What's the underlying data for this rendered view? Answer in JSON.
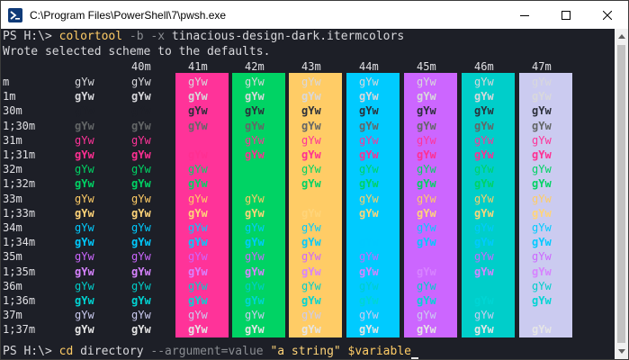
{
  "window": {
    "title": "C:\\Program Files\\PowerShell\\7\\pwsh.exe",
    "app_icon": "powershell-icon",
    "controls": [
      "minimize-icon",
      "maximize-icon",
      "close-icon"
    ]
  },
  "terminal": {
    "line1": {
      "prompt": "PS H:\\> ",
      "cmd": "colortool",
      "flag1": " -b",
      "flag2": " -x",
      "arg": " tinacious-design-dark.itermcolors"
    },
    "line2": "Wrote selected scheme to the defaults.",
    "last_line": {
      "prompt": "PS H:\\> ",
      "cmd": "cd",
      "arg1": " directory",
      "param": " --argument=value",
      "str": " \"a string\"",
      "var": " $variable"
    }
  },
  "color_table": {
    "columns": [
      "",
      "",
      "40m",
      "41m",
      "42m",
      "43m",
      "44m",
      "45m",
      "46m",
      "47m"
    ],
    "rows": [
      "m",
      "1m",
      "30m",
      "1;30m",
      "31m",
      "1;31m",
      "32m",
      "1;32m",
      "33m",
      "1;33m",
      "34m",
      "1;34m",
      "35m",
      "1;35m",
      "36m",
      "1;36m",
      "37m",
      "1;37m"
    ],
    "sample_text": "gYw",
    "background_colors": [
      "#1d1f27",
      "#1d1f27",
      "#1d1f27",
      "#ff3399",
      "#00d364",
      "#ffcc66",
      "#00cbff",
      "#cc66ff",
      "#00ceca",
      "#cbcbf0"
    ],
    "foreground_colors": {
      "default": "#d8d8dc",
      "30": "#2b2f3a",
      "1;30": "#636667",
      "31": "#ff3399",
      "1;31": "#ff2f92",
      "32": "#00d364",
      "1;32": "#00d364",
      "33": "#ffcc66",
      "1;33": "#ffd479",
      "34": "#00cbff",
      "1;34": "#00caff",
      "35": "#cc66ff",
      "1;35": "#d783ff",
      "36": "#00ceca",
      "1;36": "#00d5d4",
      "37": "#cbcbf0",
      "1;37": "#e5e5e5"
    }
  },
  "syntax_colors": {
    "prompt": "#d8d8dc",
    "command": "#ffcc66",
    "parameter": "#636667",
    "string": "#ffd479",
    "variable": "#ffcc66",
    "argument": "#d8d8dc"
  },
  "scrollbar": {
    "up_icon": "scroll-up-arrow-icon",
    "down_icon": "scroll-down-arrow-icon"
  }
}
